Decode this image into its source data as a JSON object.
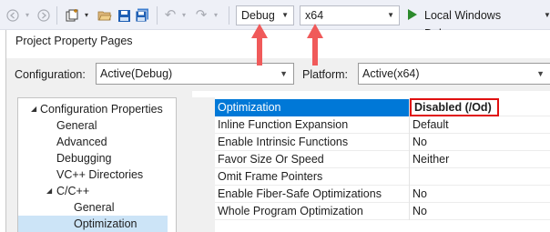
{
  "toolbar": {
    "config_combo": {
      "value": "Debug"
    },
    "platform_combo": {
      "value": "x64"
    },
    "run_button": {
      "label": "Local Windows Debugger"
    }
  },
  "dialog": {
    "title": "Project Property Pages",
    "configuration": {
      "label": "Configuration:",
      "value": "Active(Debug)"
    },
    "platform": {
      "label": "Platform:",
      "value": "Active(x64)"
    }
  },
  "tree": {
    "items": [
      {
        "label": "Configuration Properties",
        "expander": "◢",
        "level": 0
      },
      {
        "label": "General",
        "level": 1
      },
      {
        "label": "Advanced",
        "level": 1
      },
      {
        "label": "Debugging",
        "level": 1
      },
      {
        "label": "VC++ Directories",
        "level": 1
      },
      {
        "label": "C/C++",
        "expander": "◢",
        "level": 1
      },
      {
        "label": "General",
        "level": 2
      },
      {
        "label": "Optimization",
        "level": 2,
        "selected": true
      }
    ]
  },
  "properties": {
    "rows": [
      {
        "name": "Optimization",
        "value": "Disabled (/Od)",
        "selected": true
      },
      {
        "name": "Inline Function Expansion",
        "value": "Default"
      },
      {
        "name": "Enable Intrinsic Functions",
        "value": "No"
      },
      {
        "name": "Favor Size Or Speed",
        "value": "Neither"
      },
      {
        "name": "Omit Frame Pointers",
        "value": ""
      },
      {
        "name": "Enable Fiber-Safe Optimizations",
        "value": "No"
      },
      {
        "name": "Whole Program Optimization",
        "value": "No"
      }
    ]
  },
  "icons": {
    "back": "◀",
    "forward": "▶",
    "new_item": "new-item-icon",
    "open_folder": "open-folder-icon",
    "save": "save-icon",
    "save_all": "save-all-icon",
    "undo": "↶",
    "redo": "↷",
    "dropdown": "▾",
    "play": "play-icon",
    "arrow": "red-up-arrow"
  },
  "colors": {
    "selection": "#0078d7",
    "tree_selection": "#cce4f7",
    "highlight_box": "#e01010",
    "arrow": "#f05a5a",
    "run_green": "#2c8a2c"
  }
}
